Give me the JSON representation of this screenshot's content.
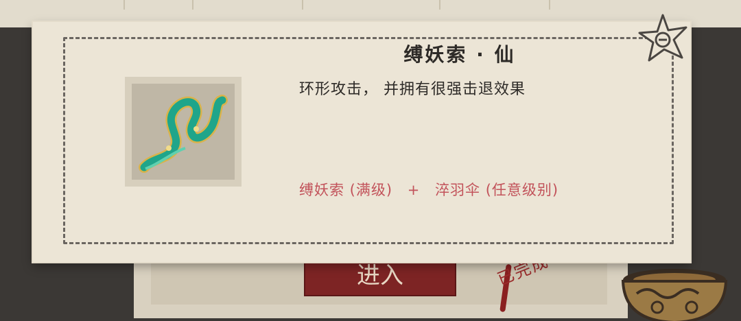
{
  "card": {
    "title": "缚妖索 · 仙",
    "description": "环形攻击， 并拥有很强击退效果",
    "recipe": {
      "ingredient_1": "缚妖索 (满级)",
      "plus": "+",
      "ingredient_2": "淬羽伞 (任意级别)"
    }
  },
  "background": {
    "enter_button_label": "进入",
    "complete_stamp": "已完成"
  },
  "icons": {
    "close": "close-star-icon",
    "item": "rope-item-icon",
    "pot": "bronze-pot-icon"
  },
  "colors": {
    "paper": "#ece5d6",
    "recipe_text": "#c2525a",
    "item_green": "#1fa58a",
    "item_gold": "#d9b34a"
  }
}
